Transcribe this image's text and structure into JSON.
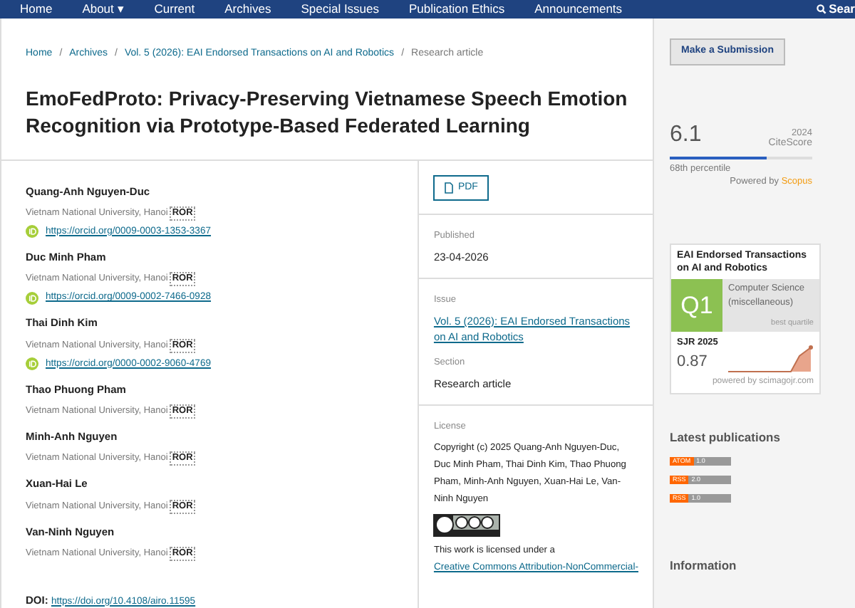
{
  "nav": {
    "items": [
      {
        "label": "Home"
      },
      {
        "label": "About",
        "caret": "▾"
      },
      {
        "label": "Current"
      },
      {
        "label": "Archives"
      },
      {
        "label": "Special Issues"
      },
      {
        "label": "Publication Ethics"
      },
      {
        "label": "Announcements"
      }
    ],
    "search": "Sear"
  },
  "breadcrumb": {
    "separator": "/",
    "items": [
      {
        "label": "Home",
        "current": false
      },
      {
        "label": "Archives",
        "current": false
      },
      {
        "label": "Vol. 5 (2026): EAI Endorsed Transactions on AI and Robotics",
        "current": false
      },
      {
        "label": "Research article",
        "current": true
      }
    ]
  },
  "title": "EmoFedProto: Privacy-Preserving Vietnamese Speech Emotion Recognition via Prototype-Based Federated Learning",
  "authors": [
    {
      "name": "Quang-Anh Nguyen-Duc",
      "affiliation": "Vietnam National University, Hanoi",
      "ror": "ROR",
      "orcid": "https://orcid.org/0009-0003-1353-3367"
    },
    {
      "name": "Duc Minh Pham",
      "affiliation": "Vietnam National University, Hanoi",
      "ror": "ROR",
      "orcid": "https://orcid.org/0009-0002-7466-0928"
    },
    {
      "name": "Thai Dinh Kim",
      "affiliation": "Vietnam National University, Hanoi",
      "ror": "ROR",
      "orcid": "https://orcid.org/0000-0002-9060-4769"
    },
    {
      "name": "Thao Phuong Pham",
      "affiliation": "Vietnam National University, Hanoi",
      "ror": "ROR"
    },
    {
      "name": "Minh-Anh Nguyen",
      "affiliation": "Vietnam National University, Hanoi",
      "ror": "ROR"
    },
    {
      "name": "Xuan-Hai Le",
      "affiliation": "Vietnam National University, Hanoi",
      "ror": "ROR"
    },
    {
      "name": "Van-Ninh Nguyen",
      "affiliation": "Vietnam National University, Hanoi",
      "ror": "ROR"
    }
  ],
  "doi": {
    "label": "DOI:",
    "url": "https://doi.org/10.4108/airo.11595"
  },
  "details": {
    "pdf": "PDF",
    "published": {
      "label": "Published",
      "value": "23-04-2026"
    },
    "issue": {
      "label": "Issue",
      "value": "Vol. 5 (2026): EAI Endorsed Transactions on AI and Robotics"
    },
    "section": {
      "label": "Section",
      "value": "Research article"
    },
    "license": {
      "label": "License",
      "text": "Copyright (c) 2025 Quang-Anh Nguyen-Duc, Duc Minh Pham, Thai Dinh Kim, Thao Phuong Pham, Minh-Anh Nguyen, Xuan-Hai Le, Van-Ninh Nguyen",
      "notice": "This work is licensed under a",
      "link": "Creative Commons Attribution-NonCommercial-"
    }
  },
  "sidebar": {
    "submit": "Make a Submission",
    "citescore": {
      "value": "6.1",
      "year": "2024",
      "label": "CiteScore",
      "level": 0.68,
      "percentile": "68th percentile",
      "powered": "Powered by",
      "brand": "Scopus"
    },
    "sjr": {
      "title": "EAI Endorsed Transactions on AI and Robotics",
      "quartile": "Q1",
      "category": "Computer Science (miscellaneous)",
      "note": "best quartile",
      "label": "SJR 2025",
      "value": "0.87",
      "footer": "powered by scimagojr.com"
    },
    "latest_heading": "Latest publications",
    "feeds": [
      {
        "format": "ATOM",
        "version": "1.0"
      },
      {
        "format": "RSS",
        "version": "2.0"
      },
      {
        "format": "RSS",
        "version": "1.0"
      }
    ],
    "info_heading": "Information"
  }
}
